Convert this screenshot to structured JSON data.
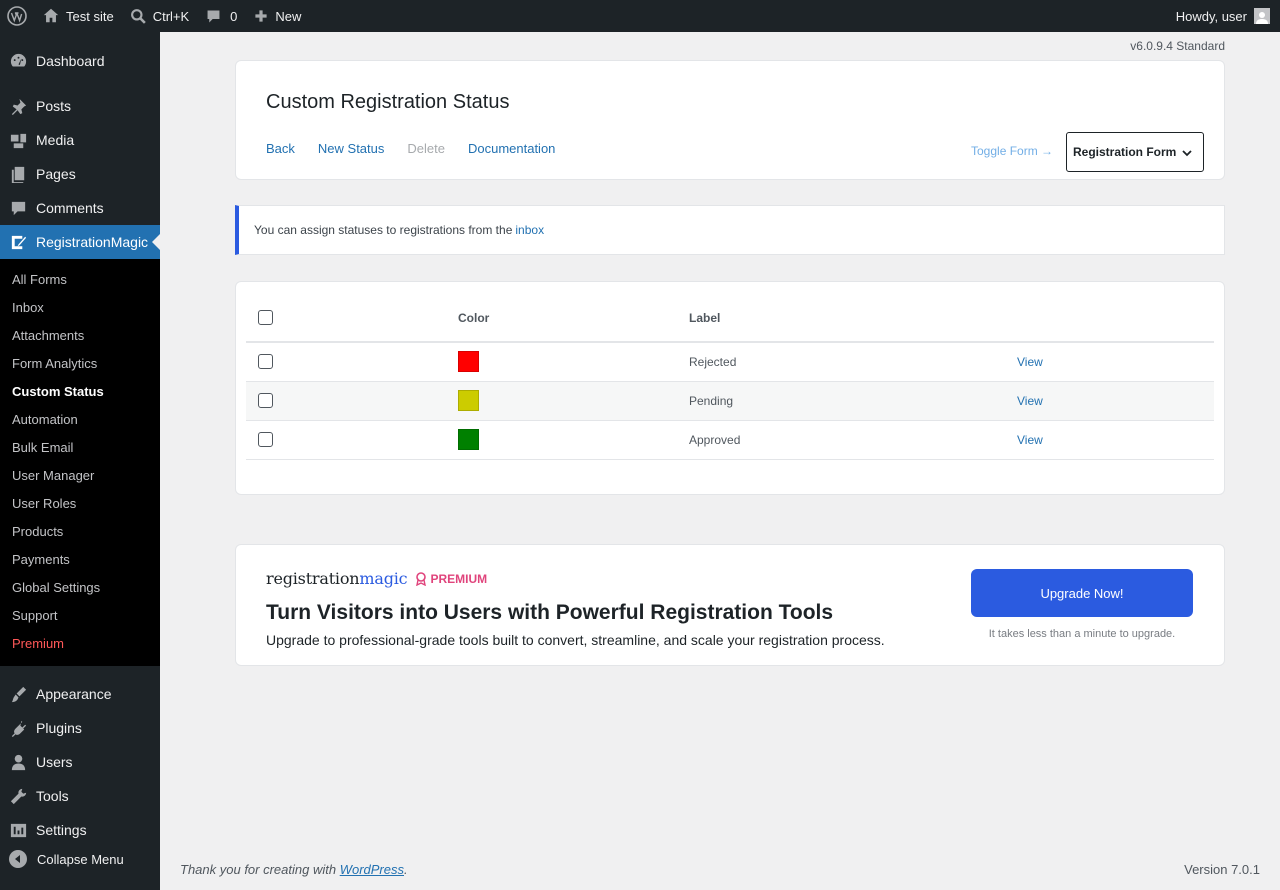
{
  "adminbar": {
    "site_name": "Test site",
    "search_shortcut": "Ctrl+K",
    "comments_count": "0",
    "new_label": "New",
    "greeting": "Howdy, user"
  },
  "sidebar": {
    "top_items": [
      {
        "label": "Dashboard",
        "icon": "dashboard-icon"
      },
      {
        "label": "Posts",
        "icon": "pin-icon"
      },
      {
        "label": "Media",
        "icon": "media-icon"
      },
      {
        "label": "Pages",
        "icon": "pages-icon"
      },
      {
        "label": "Comments",
        "icon": "comment-icon"
      },
      {
        "label": "RegistrationMagic",
        "icon": "registrationmagic-icon"
      }
    ],
    "sub_items": [
      "All Forms",
      "Inbox",
      "Attachments",
      "Form Analytics",
      "Custom Status",
      "Automation",
      "Bulk Email",
      "User Manager",
      "User Roles",
      "Products",
      "Payments",
      "Global Settings",
      "Support",
      "Premium"
    ],
    "bottom_items": [
      {
        "label": "Appearance",
        "icon": "brush-icon"
      },
      {
        "label": "Plugins",
        "icon": "plugin-icon"
      },
      {
        "label": "Users",
        "icon": "users-icon"
      },
      {
        "label": "Tools",
        "icon": "wrench-icon"
      },
      {
        "label": "Settings",
        "icon": "settings-icon"
      }
    ],
    "collapse_label": "Collapse Menu"
  },
  "version_top": "v6.0.9.4 Standard",
  "header": {
    "title": "Custom Registration Status",
    "actions": [
      "Back",
      "New Status",
      "Delete",
      "Documentation"
    ],
    "toggle_label": "Toggle Form →",
    "form_select": "Registration Form"
  },
  "notice": {
    "text": "You can assign statuses to registrations from the",
    "link": "inbox"
  },
  "table": {
    "headers": {
      "color": "Color",
      "label": "Label"
    },
    "rows": [
      {
        "color": "#ff0000",
        "label": "Rejected",
        "action": "View"
      },
      {
        "color": "#cccc00",
        "label": "Pending",
        "action": "View"
      },
      {
        "color": "#008000",
        "label": "Approved",
        "action": "View"
      }
    ]
  },
  "promo": {
    "logo_part1": "registration",
    "logo_part2": "magic",
    "badge": "PREMIUM",
    "title": "Turn Visitors into Users with Powerful Registration Tools",
    "subtitle": "Upgrade to professional-grade tools built to convert, streamline, and scale your registration process.",
    "button": "Upgrade Now!",
    "note": "It takes less than a minute to upgrade."
  },
  "footer": {
    "thanks_prefix": "Thank you for creating with",
    "link": "WordPress",
    "suffix": ".",
    "version": "Version 7.0.1"
  },
  "colors": {
    "accent": "#2b5be0",
    "wp_blue": "#2271b1",
    "premium": "#e0447c"
  }
}
